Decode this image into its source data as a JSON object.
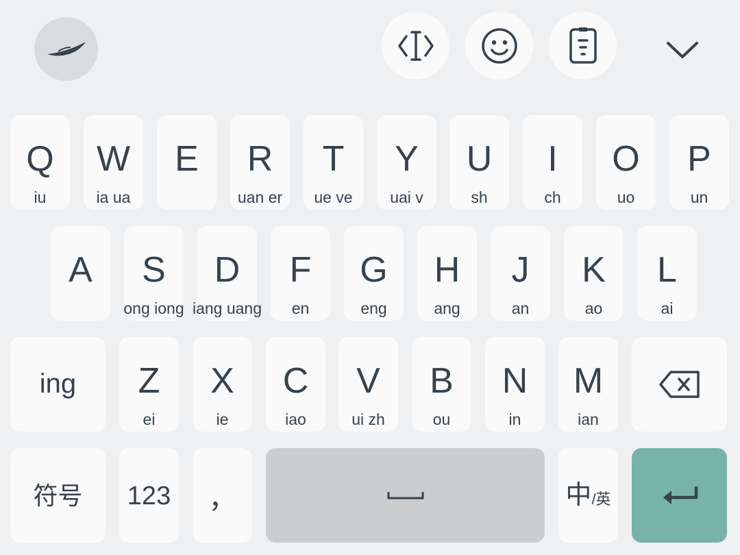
{
  "keyboard": {
    "row1": [
      {
        "main": "Q",
        "sub": "iu"
      },
      {
        "main": "W",
        "sub": "ia ua"
      },
      {
        "main": "E",
        "sub": ""
      },
      {
        "main": "R",
        "sub": "uan er"
      },
      {
        "main": "T",
        "sub": "ue ve"
      },
      {
        "main": "Y",
        "sub": "uai v"
      },
      {
        "main": "U",
        "sub": "sh"
      },
      {
        "main": "I",
        "sub": "ch"
      },
      {
        "main": "O",
        "sub": "uo"
      },
      {
        "main": "P",
        "sub": "un"
      }
    ],
    "row2": [
      {
        "main": "A",
        "sub": ""
      },
      {
        "main": "S",
        "sub": "ong iong"
      },
      {
        "main": "D",
        "sub": "iang uang"
      },
      {
        "main": "F",
        "sub": "en"
      },
      {
        "main": "G",
        "sub": "eng"
      },
      {
        "main": "H",
        "sub": "ang"
      },
      {
        "main": "J",
        "sub": "an"
      },
      {
        "main": "K",
        "sub": "ao"
      },
      {
        "main": "L",
        "sub": "ai"
      }
    ],
    "row3": {
      "ing_label": "ing",
      "keys": [
        {
          "main": "Z",
          "sub": "ei"
        },
        {
          "main": "X",
          "sub": "ie"
        },
        {
          "main": "C",
          "sub": "iao"
        },
        {
          "main": "V",
          "sub": "ui zh"
        },
        {
          "main": "B",
          "sub": "ou"
        },
        {
          "main": "N",
          "sub": "in"
        },
        {
          "main": "M",
          "sub": "ian"
        }
      ]
    },
    "row4": {
      "symbols_label": "符号",
      "numbers_label": "123",
      "comma_label": "，",
      "lang_main": "中",
      "lang_sub": "/英"
    }
  },
  "toolbar": {
    "icons": [
      "logo-icon",
      "cursor-icon",
      "emoji-icon",
      "clipboard-icon",
      "chevron-down-icon"
    ]
  },
  "colors": {
    "background": "#eef0f2",
    "key": "#fafafa",
    "space": "#cbcdcf",
    "enter": "#78b3aa",
    "text": "#37424d"
  }
}
